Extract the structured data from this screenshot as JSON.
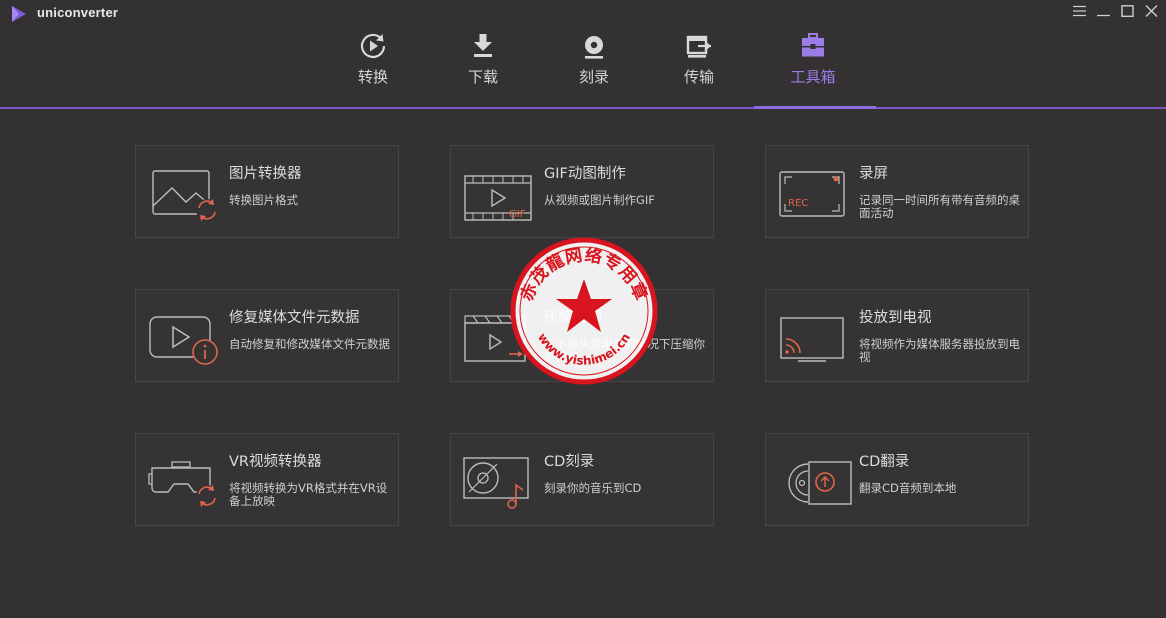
{
  "app": {
    "title": "uniconverter"
  },
  "colors": {
    "accent": "#8e6be0",
    "icon_accent": "#e0654a",
    "background": "#333132"
  },
  "nav": {
    "tabs": [
      {
        "label": "转换",
        "icon": "convert-icon"
      },
      {
        "label": "下载",
        "icon": "download-icon"
      },
      {
        "label": "刻录",
        "icon": "burn-disc-icon"
      },
      {
        "label": "传输",
        "icon": "transfer-icon"
      },
      {
        "label": "工具箱",
        "icon": "toolbox-icon",
        "active": true
      }
    ]
  },
  "toolbox": {
    "cards": [
      {
        "title": "图片转换器",
        "desc": "转换图片格式",
        "icon": "image-convert-icon"
      },
      {
        "title": "GIF动图制作",
        "desc": "从视频或图片制作GIF",
        "icon": "gif-maker-icon",
        "icon_text": "GIF"
      },
      {
        "title": "录屏",
        "desc": "记录同一时间所有带有音频的桌面活动",
        "icon": "screen-record-icon",
        "icon_text": "REC"
      },
      {
        "title": "修复媒体文件元数据",
        "desc": "自动修复和修改媒体文件元数据",
        "icon": "metadata-fix-icon"
      },
      {
        "title": "压缩视频",
        "desc": "在不损失清晰度的情况下压缩你的视频",
        "icon": "compress-video-icon"
      },
      {
        "title": "投放到电视",
        "desc": "将视频作为媒体服务器投放到电视",
        "icon": "cast-tv-icon"
      },
      {
        "title": "VR视频转换器",
        "desc": "将视频转换为VR格式并在VR设备上放映",
        "icon": "vr-convert-icon"
      },
      {
        "title": "CD刻录",
        "desc": "刻录你的音乐到CD",
        "icon": "cd-burn-icon"
      },
      {
        "title": "CD翻录",
        "desc": "翻录CD音频到本地",
        "icon": "cd-rip-icon"
      }
    ]
  },
  "watermark": {
    "top_text": "赤茂龍网络专用章",
    "bottom_text": "www.yishimei.cn"
  }
}
